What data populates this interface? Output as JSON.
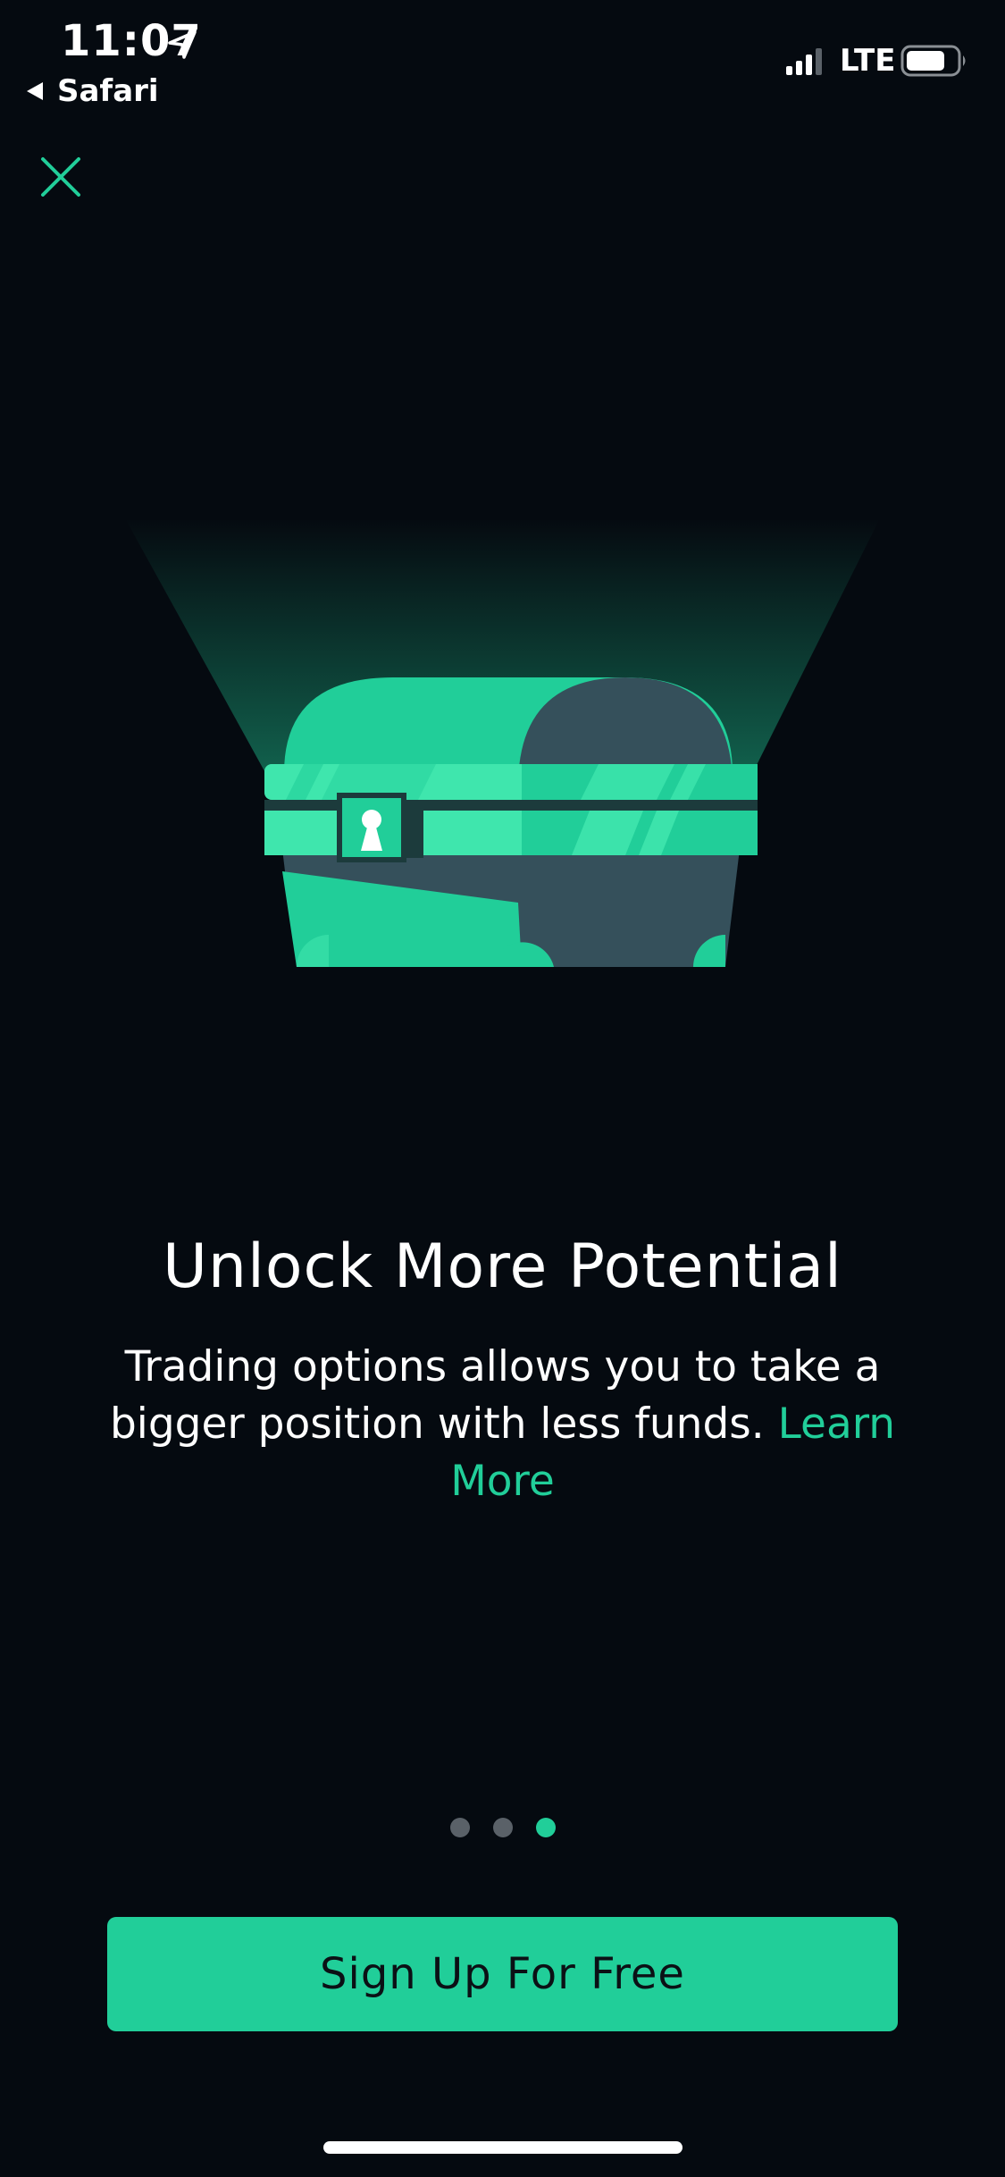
{
  "status_bar": {
    "time": "11:07",
    "back_app": "Safari",
    "network": "LTE",
    "icons": [
      "location-arrow-icon",
      "back-arrow-icon",
      "signal-icon",
      "battery-icon"
    ]
  },
  "header": {
    "close_icon": "close-icon"
  },
  "illustration": {
    "icon": "treasure-chest-icon"
  },
  "content": {
    "title": "Unlock More Potential",
    "body": "Trading options allows you to take a bigger position with less funds.",
    "learn_more": "Learn More"
  },
  "pager": {
    "count": 3,
    "active_index": 2
  },
  "cta": {
    "label": "Sign Up For Free"
  },
  "colors": {
    "background": "#050a10",
    "accent": "#21ce99",
    "accent_light": "#3fe6ad",
    "chest_shadow": "#35505b",
    "dot_inactive": "#5a6168"
  }
}
